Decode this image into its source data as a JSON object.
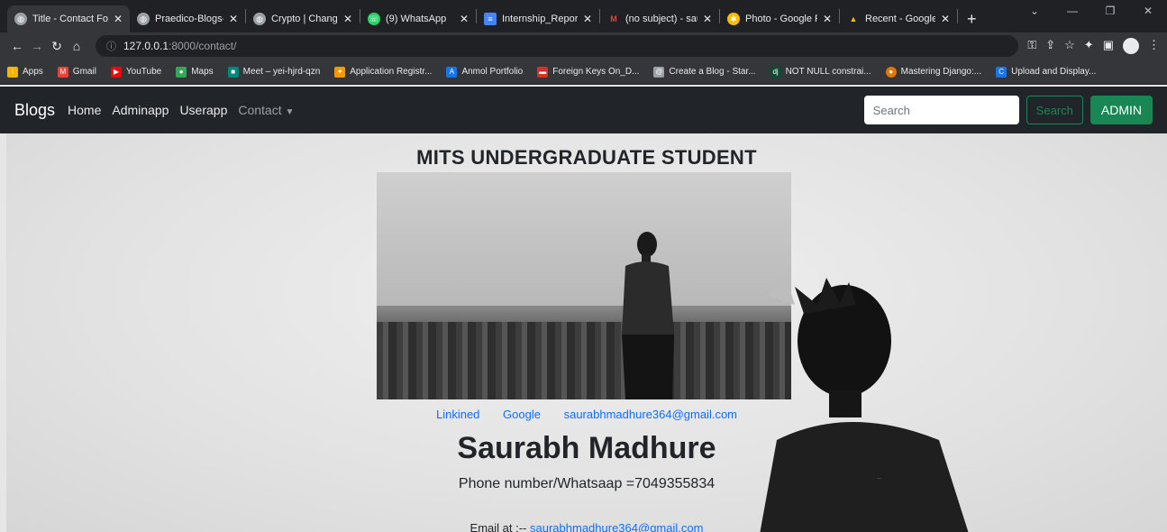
{
  "browser": {
    "tabs": [
      {
        "title": "Title - Contact For",
        "icon": "globe-icon",
        "active": true
      },
      {
        "title": "Praedico-Blogs-",
        "icon": "globe-icon"
      },
      {
        "title": "Crypto | Change",
        "icon": "globe-icon"
      },
      {
        "title": "(9) WhatsApp",
        "icon": "whatsapp-icon"
      },
      {
        "title": "Internship_Repor",
        "icon": "docs-icon"
      },
      {
        "title": "(no subject) - sau",
        "icon": "gmail-icon"
      },
      {
        "title": "Photo - Google P",
        "icon": "photos-icon"
      },
      {
        "title": "Recent - Google D",
        "icon": "drive-icon"
      }
    ],
    "url_host": "127.0.0.1",
    "url_path": ":8000/contact/",
    "bookmarks": [
      {
        "label": "Apps",
        "icon": "apps-icon",
        "color": "#f4b400"
      },
      {
        "label": "Gmail",
        "icon": "gmail-icon",
        "color": "#ea4335"
      },
      {
        "label": "YouTube",
        "icon": "youtube-icon",
        "color": "#ff0000"
      },
      {
        "label": "Maps",
        "icon": "maps-icon",
        "color": "#34a853"
      },
      {
        "label": "Meet – yei-hjrd-qzn",
        "icon": "meet-icon",
        "color": "#00897b"
      },
      {
        "label": "Application Registr...",
        "icon": "app-icon",
        "color": "#f29900"
      },
      {
        "label": "Anmol Portfolio",
        "icon": "portfolio-icon",
        "color": "#1a73e8"
      },
      {
        "label": "Foreign Keys On_D...",
        "icon": "bookmark-icon",
        "color": "#d93025"
      },
      {
        "label": "Create a Blog - Star...",
        "icon": "blog-icon",
        "color": "#9aa0a6"
      },
      {
        "label": "NOT NULL constrai...",
        "icon": "django-icon",
        "color": "#0c4b33"
      },
      {
        "label": "Mastering Django:...",
        "icon": "bookmark-icon",
        "color": "#e37400"
      },
      {
        "label": "Upload and Display...",
        "icon": "bookmark-icon",
        "color": "#1a73e8"
      }
    ]
  },
  "navbar": {
    "brand": "Blogs",
    "links": [
      "Home",
      "Adminapp",
      "Userapp"
    ],
    "dropdown": "Contact",
    "search_placeholder": "Search",
    "search_button": "Search",
    "admin_button": "ADMIN"
  },
  "page": {
    "heading": "MITS UNDERGRADUATE STUDENT",
    "links": [
      "Linkined",
      "Google",
      "saurabhmadhure364@gmail.com"
    ],
    "name": "Saurabh Madhure",
    "phone": "Phone number/Whatsaap =7049355834",
    "email_prefix": "Email at :-- ",
    "email": "saurabhmadhure364@gmail.com"
  },
  "colors": {
    "accent": "#198754",
    "link": "#0d6efd",
    "navbar": "#212529"
  }
}
